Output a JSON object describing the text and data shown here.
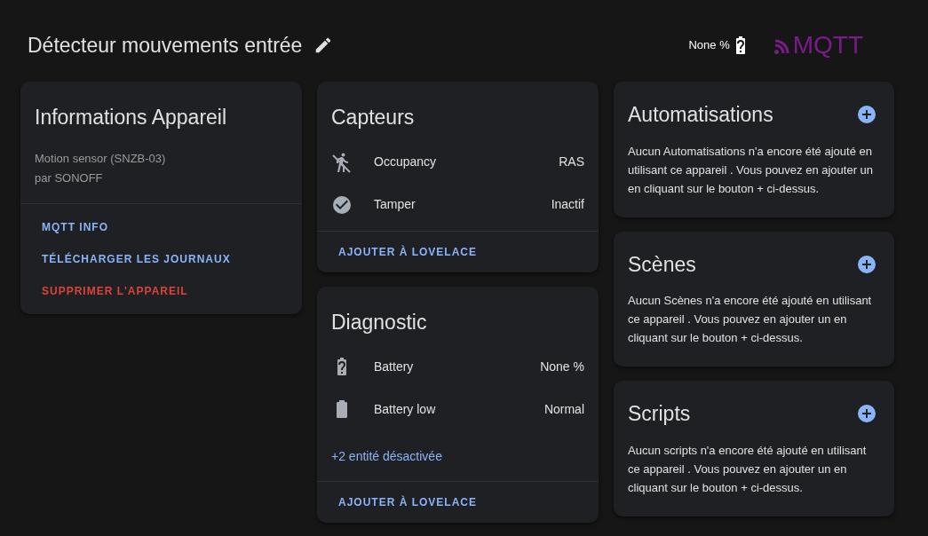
{
  "header": {
    "title": "Détecteur mouvements entrée",
    "battery": "None %",
    "logo": "MQTT"
  },
  "info_card": {
    "title": "Informations Appareil",
    "model": "Motion sensor (SNZB-03)",
    "manufacturer": "par SONOFF",
    "actions": [
      {
        "label": "MQTT INFO",
        "kind": "normal"
      },
      {
        "label": "TÉLÉCHARGER LES JOURNAUX",
        "kind": "normal"
      },
      {
        "label": "SUPPRIMER L'APPAREIL",
        "kind": "danger"
      }
    ]
  },
  "entity_cards": [
    {
      "title": "Capteurs",
      "entities": [
        {
          "name": "Occupancy",
          "state": "RAS",
          "kind": "walk"
        },
        {
          "name": "Tamper",
          "state": "Inactif",
          "kind": "check"
        }
      ],
      "action": "AJOUTER À LOVELACE"
    },
    {
      "title": "Diagnostic",
      "entities": [
        {
          "name": "Battery",
          "state": "None %",
          "kind": "battery-unknown"
        },
        {
          "name": "Battery low",
          "state": "Normal",
          "kind": "battery"
        }
      ],
      "disabled_link": "+2 entité désactivée",
      "action": "AJOUTER À LOVELACE"
    }
  ],
  "related_cards": [
    {
      "title": "Automatisations",
      "text": "Aucun Automatisations n'a encore été ajouté en utilisant ce appareil . Vous pouvez en ajouter un en cliquant sur le bouton + ci-dessus."
    },
    {
      "title": "Scènes",
      "text": "Aucun Scènes n'a encore été ajouté en utilisant ce appareil . Vous pouvez en ajouter un en cliquant sur le bouton + ci-dessus."
    },
    {
      "title": "Scripts",
      "text": "Aucun scripts n'a encore été ajouté en utilisant ce appareil . Vous pouvez en ajouter un en cliquant sur le bouton + ci-dessus."
    }
  ]
}
